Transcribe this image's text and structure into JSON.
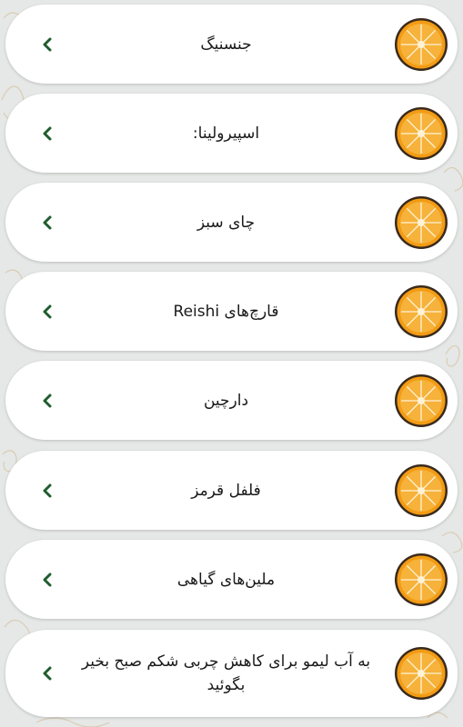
{
  "items": [
    {
      "label": "جنسنیگ"
    },
    {
      "label": "اسپیرولینا:"
    },
    {
      "label": "چای سبز"
    },
    {
      "label": "قارچ‌های Reishi"
    },
    {
      "label": "دارچین"
    },
    {
      "label": "فلفل قرمز"
    },
    {
      "label": "ملین‌های گیاهی"
    },
    {
      "label": "به آب لیمو برای کاهش چربی شکم  صبح بخیر بگوئید"
    }
  ],
  "icons": {
    "chevron": "chevron-left-icon",
    "thumbnail": "orange-slice-icon"
  },
  "colors": {
    "chevron": "#1f5d2e",
    "orange": "#f29b14",
    "card": "#ffffff",
    "background": "#e5e8e6"
  }
}
